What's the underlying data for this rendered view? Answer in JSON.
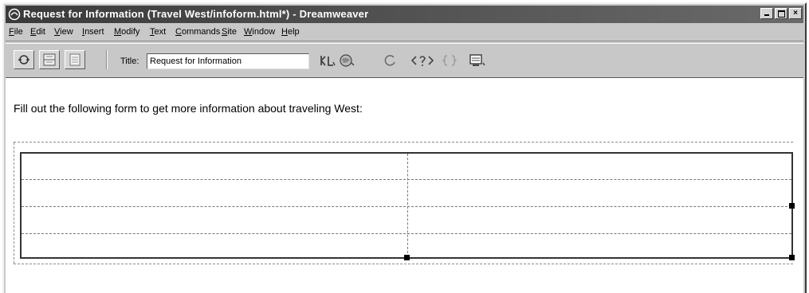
{
  "window": {
    "title": "Request for Information (Travel West/infoform.html*) - Dreamweaver",
    "buttons": [
      "minimize",
      "maximize",
      "close"
    ],
    "close_glyph": "×"
  },
  "menubar": {
    "items": [
      "File",
      "Edit",
      "View",
      "Insert",
      "Modify",
      "Text",
      "Commands",
      "Site",
      "Window",
      "Help"
    ]
  },
  "toolbar": {
    "title_label": "Title:",
    "title_value": "Request for Information",
    "view_buttons": [
      "code-view-icon",
      "split-view-icon",
      "design-view-icon"
    ],
    "tools": [
      "file-management-icon",
      "preview-in-browser-icon",
      "refresh-icon",
      "reference-icon",
      "code-navigation-icon",
      "view-options-icon"
    ]
  },
  "document": {
    "intro_text": "Fill out the following form to get more information about traveling West:",
    "table": {
      "rows": 4,
      "columns": 2
    }
  }
}
